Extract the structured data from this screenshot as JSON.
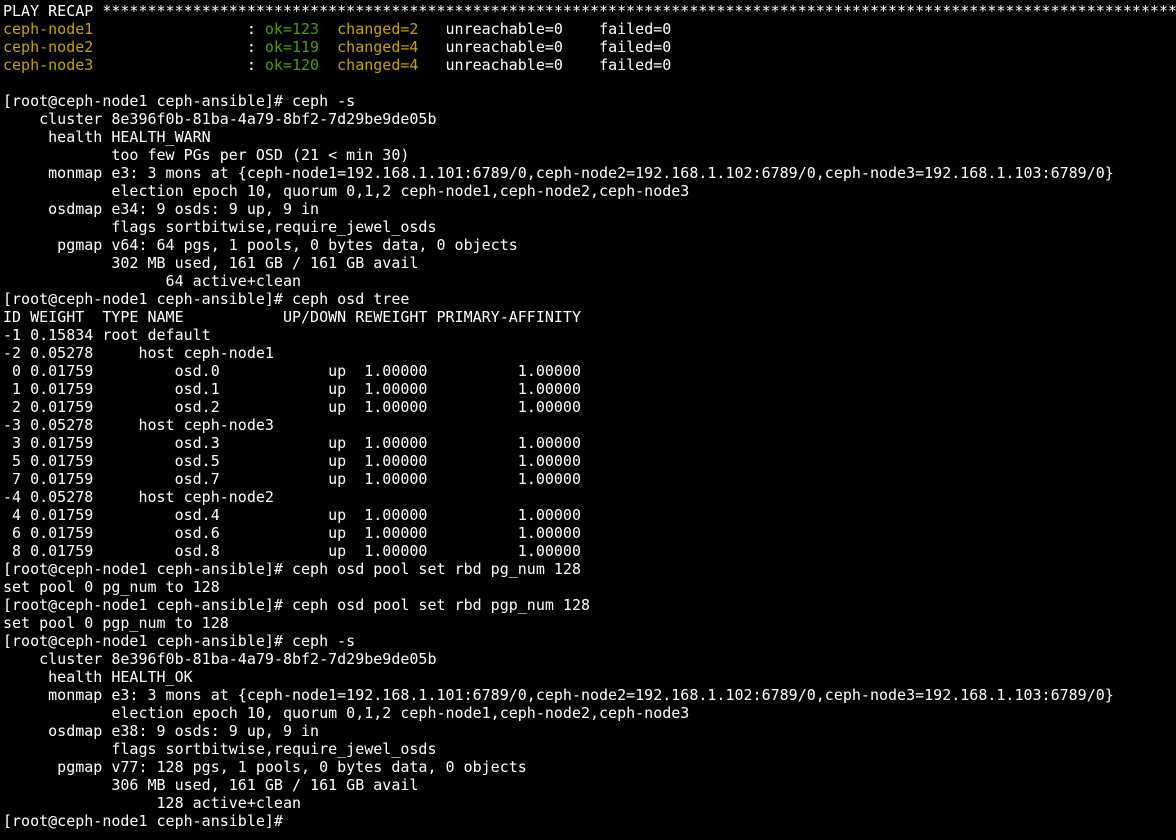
{
  "colors": {
    "background": "#000000",
    "text": "#ffffff",
    "host": "#c4a000",
    "ok": "#4e9a06",
    "changed": "#c4a000"
  },
  "recap": {
    "header": "PLAY RECAP *********************************************************************************************************************************************",
    "hosts": [
      {
        "name": "ceph-node1                ",
        "sep": " : ",
        "ok": "ok=123",
        "changed": "changed=2 ",
        "unreachable": "unreachable=0",
        "failed": "failed=0"
      },
      {
        "name": "ceph-node2                ",
        "sep": " : ",
        "ok": "ok=119",
        "changed": "changed=4 ",
        "unreachable": "unreachable=0",
        "failed": "failed=0"
      },
      {
        "name": "ceph-node3                ",
        "sep": " : ",
        "ok": "ok=120",
        "changed": "changed=4 ",
        "unreachable": "unreachable=0",
        "failed": "failed=0"
      }
    ]
  },
  "lines": [
    "",
    "[root@ceph-node1 ceph-ansible]# ceph -s",
    "    cluster 8e396f0b-81ba-4a79-8bf2-7d29be9de05b",
    "     health HEALTH_WARN",
    "            too few PGs per OSD (21 < min 30)",
    "     monmap e3: 3 mons at {ceph-node1=192.168.1.101:6789/0,ceph-node2=192.168.1.102:6789/0,ceph-node3=192.168.1.103:6789/0}",
    "            election epoch 10, quorum 0,1,2 ceph-node1,ceph-node2,ceph-node3",
    "     osdmap e34: 9 osds: 9 up, 9 in",
    "            flags sortbitwise,require_jewel_osds",
    "      pgmap v64: 64 pgs, 1 pools, 0 bytes data, 0 objects",
    "            302 MB used, 161 GB / 161 GB avail",
    "                  64 active+clean",
    "[root@ceph-node1 ceph-ansible]# ceph osd tree",
    "ID WEIGHT  TYPE NAME           UP/DOWN REWEIGHT PRIMARY-AFFINITY",
    "-1 0.15834 root default",
    "-2 0.05278     host ceph-node1",
    " 0 0.01759         osd.0            up  1.00000          1.00000",
    " 1 0.01759         osd.1            up  1.00000          1.00000",
    " 2 0.01759         osd.2            up  1.00000          1.00000",
    "-3 0.05278     host ceph-node3",
    " 3 0.01759         osd.3            up  1.00000          1.00000",
    " 5 0.01759         osd.5            up  1.00000          1.00000",
    " 7 0.01759         osd.7            up  1.00000          1.00000",
    "-4 0.05278     host ceph-node2",
    " 4 0.01759         osd.4            up  1.00000          1.00000",
    " 6 0.01759         osd.6            up  1.00000          1.00000",
    " 8 0.01759         osd.8            up  1.00000          1.00000",
    "[root@ceph-node1 ceph-ansible]# ceph osd pool set rbd pg_num 128",
    "set pool 0 pg_num to 128",
    "[root@ceph-node1 ceph-ansible]# ceph osd pool set rbd pgp_num 128",
    "set pool 0 pgp_num to 128",
    "[root@ceph-node1 ceph-ansible]# ceph -s",
    "    cluster 8e396f0b-81ba-4a79-8bf2-7d29be9de05b",
    "     health HEALTH_OK",
    "     monmap e3: 3 mons at {ceph-node1=192.168.1.101:6789/0,ceph-node2=192.168.1.102:6789/0,ceph-node3=192.168.1.103:6789/0}",
    "            election epoch 10, quorum 0,1,2 ceph-node1,ceph-node2,ceph-node3",
    "     osdmap e38: 9 osds: 9 up, 9 in",
    "            flags sortbitwise,require_jewel_osds",
    "      pgmap v77: 128 pgs, 1 pools, 0 bytes data, 0 objects",
    "            306 MB used, 161 GB / 161 GB avail",
    "                 128 active+clean"
  ],
  "prompt": "[root@ceph-node1 ceph-ansible]# "
}
